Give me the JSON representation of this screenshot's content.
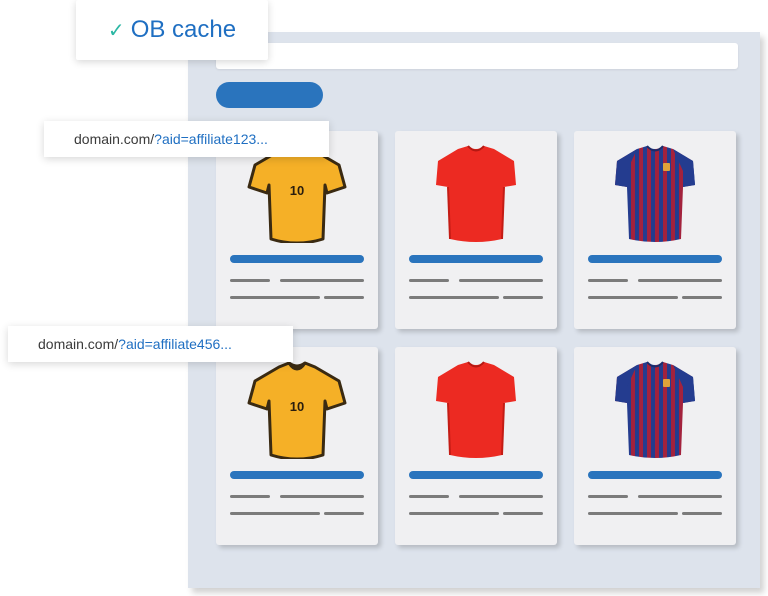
{
  "badge": {
    "check_icon": "✓",
    "label": "OB cache"
  },
  "url_tags": [
    {
      "domain": "domain.com/",
      "param": "?aid=affiliate123..."
    },
    {
      "domain": "domain.com/",
      "param": "?aid=affiliate456..."
    }
  ],
  "products": [
    {
      "icon": "yellow-jersey-icon",
      "number": "10"
    },
    {
      "icon": "red-jersey-icon"
    },
    {
      "icon": "striped-jersey-icon"
    },
    {
      "icon": "yellow-jersey-icon",
      "number": "10"
    },
    {
      "icon": "red-jersey-icon"
    },
    {
      "icon": "striped-jersey-icon"
    }
  ],
  "colors": {
    "accent_blue": "#2a74bd",
    "check_green": "#2bb7a4",
    "panel_bg": "#dde3ec",
    "card_bg": "#f0f0f2",
    "jersey_yellow": "#f5b027",
    "jersey_red": "#ec2a22",
    "jersey_navy": "#243c8f",
    "jersey_stripe": "#a3223d"
  }
}
